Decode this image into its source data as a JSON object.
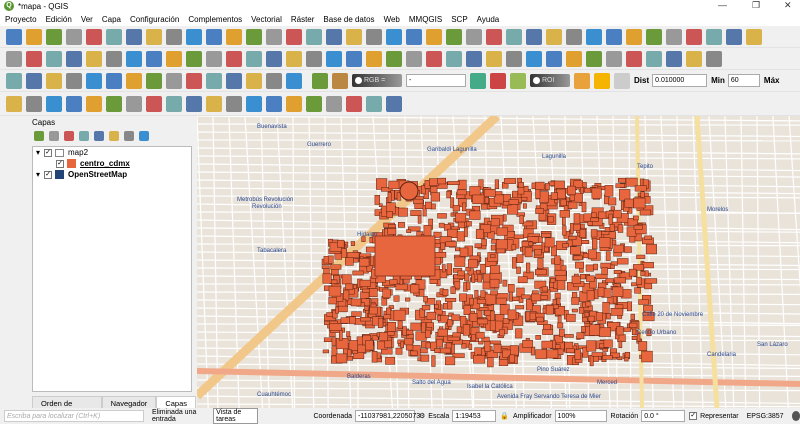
{
  "window": {
    "title": "*mapa - QGIS",
    "min": "—",
    "max": "❐",
    "close": "✕"
  },
  "menu": [
    "Proyecto",
    "Edición",
    "Ver",
    "Capa",
    "Configuración",
    "Complementos",
    "Vectorial",
    "Ráster",
    "Base de datos",
    "Web",
    "MMQGIS",
    "SCP",
    "Ayuda"
  ],
  "scp_toolbar": {
    "rgb": "RGB =",
    "rgb_value": "-",
    "roi": "ROI",
    "dist_label": "Dist",
    "dist_value": "0.010000",
    "min_label": "Min",
    "min_value": "60",
    "max_label": "Máx",
    "more": "»"
  },
  "toolbar2": {
    "spin_value": "0"
  },
  "layers_panel": {
    "title": "Capas",
    "layers": [
      {
        "name": "map2",
        "checked": true,
        "group": true
      },
      {
        "name": "centro_cdmx",
        "checked": true,
        "color": "#e8663d"
      },
      {
        "name": "OpenStreetMap",
        "checked": true
      }
    ],
    "tabs": [
      "Orden de capas",
      "Navegador",
      "Capas"
    ],
    "active_tab": "Capas"
  },
  "map": {
    "polygon_color": "#e8663d",
    "labels": [
      "Buenavista",
      "Guerrero",
      "Garibaldi Lagunilla",
      "Lagunilla",
      "Tepito",
      "Revolución",
      "Metrobús Revolución",
      "Tabacalera",
      "Hidalgo",
      "Balderas",
      "Salto del Agua",
      "Isabel la Católica",
      "Pino Suárez",
      "Morelos",
      "Candelaria",
      "San Lázaro",
      "Cuauhtémoc",
      "Merced",
      "Avenida Fray Servando Teresa de Mier",
      "Calle 20 de Noviembre",
      "Centro Urbano"
    ]
  },
  "status": {
    "search_placeholder": "Escriba para localizar (Ctrl+K)",
    "message": "Eliminada una entrada",
    "tooltip": "Vista de tareas",
    "coord_label": "Coordenada",
    "coord_value": "-11037981,2205073",
    "scale_label": "Escala",
    "scale_value": "1:19453",
    "magnifier_label": "Amplificador",
    "magnifier_value": "100%",
    "rotation_label": "Rotación",
    "rotation_value": "0.0 °",
    "render_label": "Representar",
    "render_checked": true,
    "crs": "EPSG:3857"
  }
}
